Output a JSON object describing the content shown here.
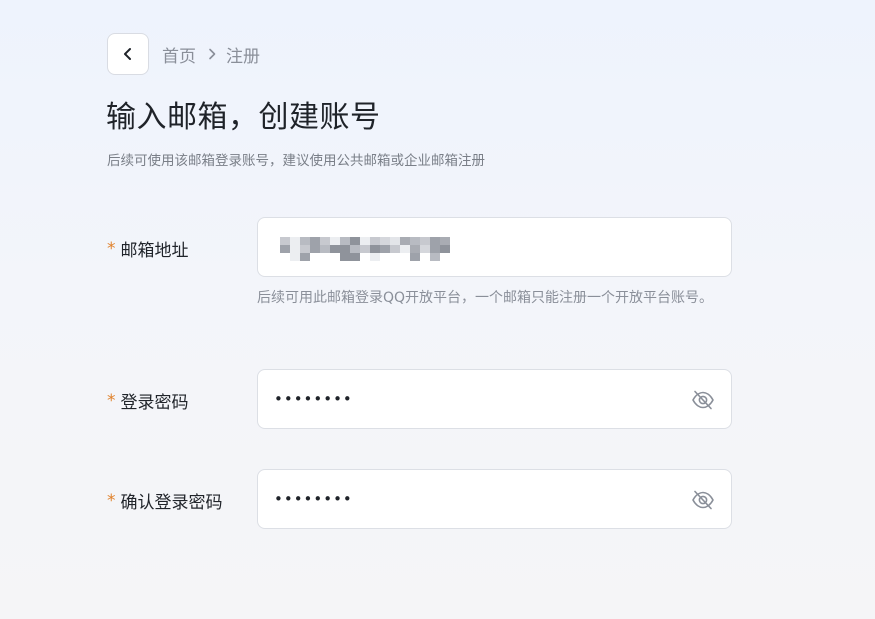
{
  "breadcrumb": {
    "home": "首页",
    "current": "注册"
  },
  "title": "输入邮箱，创建账号",
  "subtitle": "后续可使用该邮箱登录账号，建议使用公共邮箱或企业邮箱注册",
  "fields": {
    "email": {
      "required_mark": "*",
      "label": "邮箱地址",
      "hint": "后续可用此邮箱登录QQ开放平台，一个邮箱只能注册一个开放平台账号。"
    },
    "password": {
      "required_mark": "*",
      "label": "登录密码",
      "value": "••••••••",
      "toggle_icon": "eye-off-icon"
    },
    "confirm_password": {
      "required_mark": "*",
      "label": "确认登录密码",
      "value": "••••••••",
      "toggle_icon": "eye-off-icon"
    }
  },
  "colors": {
    "required": "#e0822c",
    "text": "#1f2329",
    "muted": "#8a8f99"
  }
}
